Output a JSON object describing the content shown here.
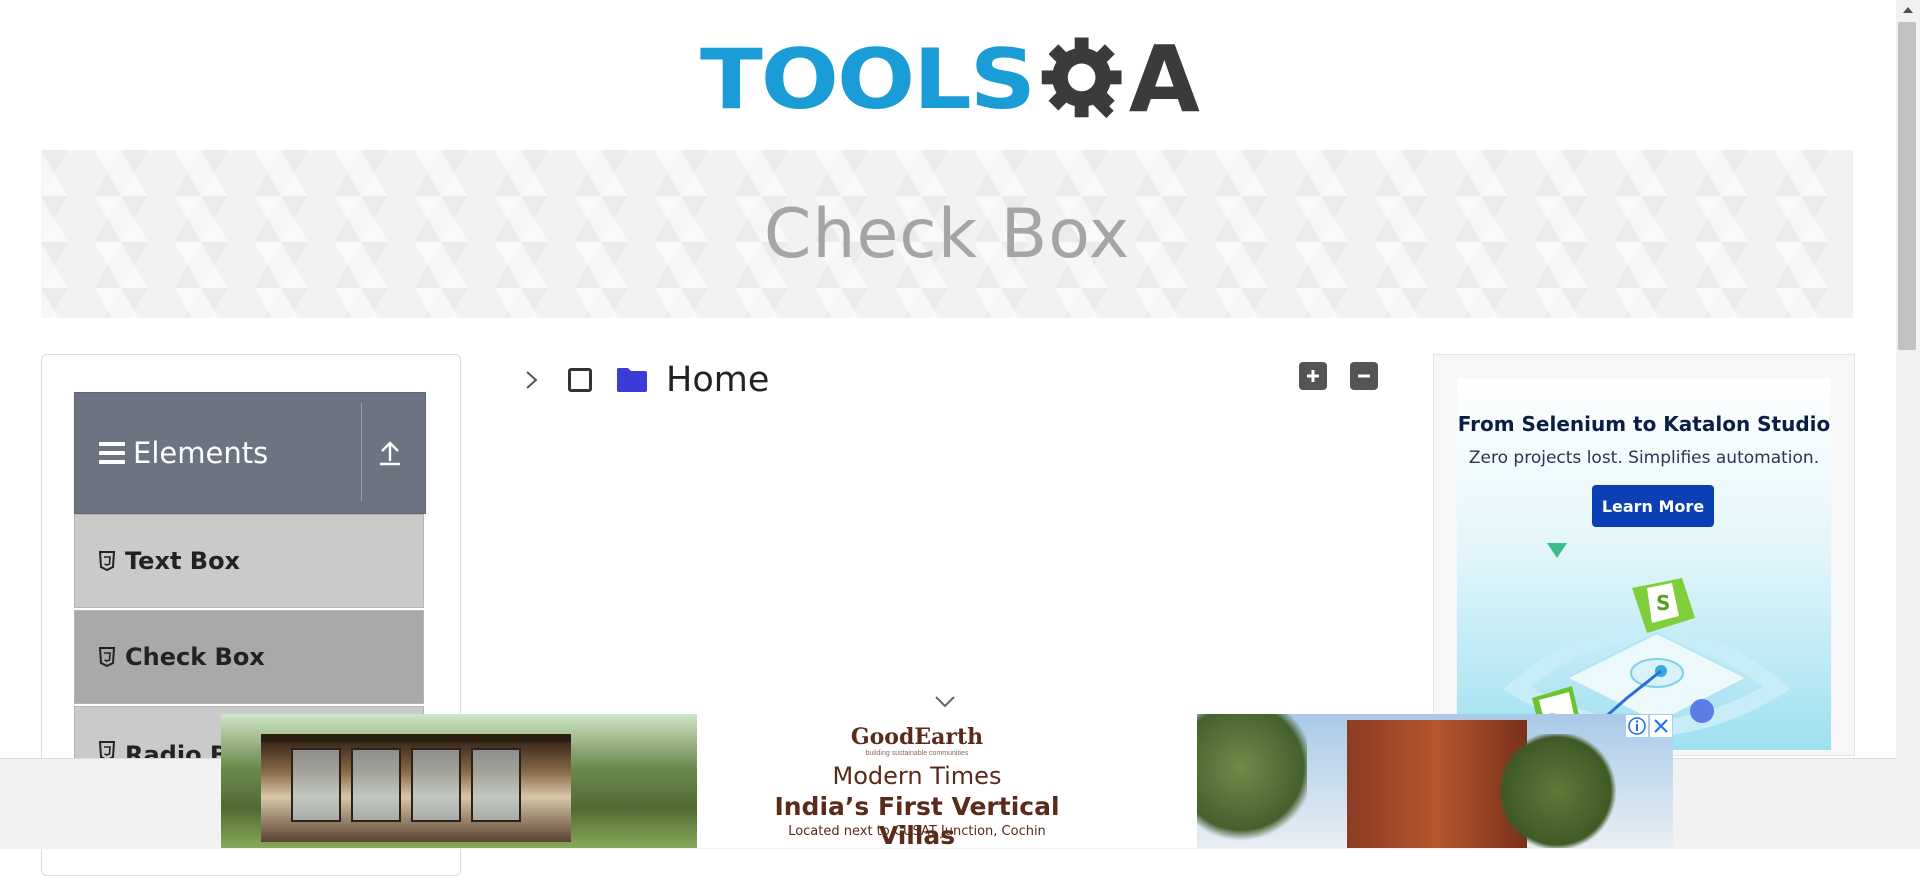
{
  "logo": {
    "part1": "TOOLS",
    "part2": "A"
  },
  "banner": {
    "title": "Check Box"
  },
  "sidebar": {
    "group_title": "Elements",
    "items": [
      {
        "label": "Text Box"
      },
      {
        "label": "Check Box"
      },
      {
        "label": "Radio Bu"
      }
    ]
  },
  "tree": {
    "root_label": "Home"
  },
  "right_ad": {
    "headline": "From Selenium to Katalon Studio",
    "subtext": "Zero projects lost. Simplifies automation.",
    "cta": "Learn More"
  },
  "bottom_ad": {
    "brand": "GoodEarth",
    "tagline": "building sustainable communities",
    "line1": "Modern Times",
    "line2": "India’s First  Vertical Villas",
    "line3": "Located next to CUSAT Junction, Cochin"
  },
  "colors": {
    "logo_blue": "#1a9dd6",
    "group_header": "#6b7480",
    "active_item": "#a9a9a9",
    "folder_icon": "#3b3bd6",
    "cta_button": "#0b3fb3"
  }
}
